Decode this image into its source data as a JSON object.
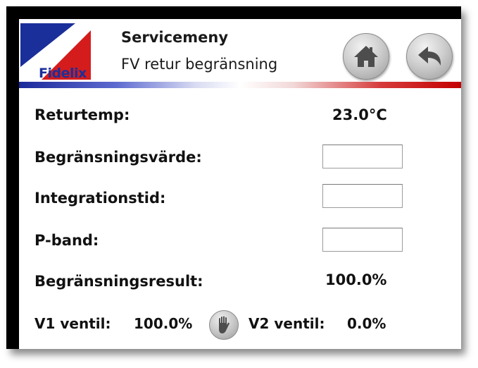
{
  "header": {
    "logo_text": "Fidelix",
    "title": "Servicemeny",
    "subtitle": "FV retur begränsning",
    "home_icon": "home-icon",
    "back_icon": "back-arrow-icon"
  },
  "rows": {
    "returtemp": {
      "label": "Returtemp:",
      "value": "23.0°C"
    },
    "begransningsvarde": {
      "label": "Begränsningsvärde:",
      "value": ""
    },
    "integrationstid": {
      "label": "Integrationstid:",
      "value": ""
    },
    "p_band": {
      "label": "P-band:",
      "value": ""
    },
    "begransningsresult": {
      "label": "Begränsningsresult:",
      "value": "100.0%"
    }
  },
  "valves": {
    "v1_label": "V1 ventil:",
    "v1_value": "100.0%",
    "manual_icon": "hand-icon",
    "v2_label": "V2 ventil:",
    "v2_value": "0.0%"
  },
  "colors": {
    "brand_blue": "#1b2f9a",
    "brand_red": "#c40000"
  }
}
